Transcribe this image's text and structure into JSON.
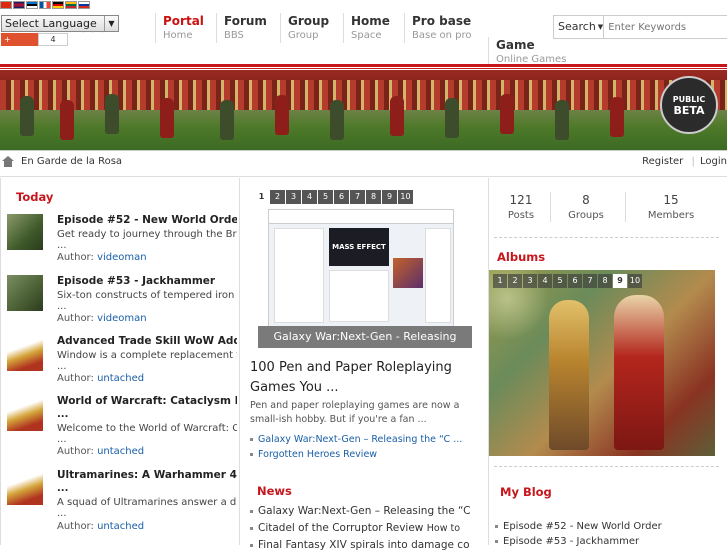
{
  "header": {
    "language_select": "Select Language",
    "share_label": "Share",
    "share_count": "4",
    "nav": [
      {
        "title": "Portal",
        "sub": "Home"
      },
      {
        "title": "Forum",
        "sub": "BBS"
      },
      {
        "title": "Group",
        "sub": "Group"
      },
      {
        "title": "Home",
        "sub": "Space"
      },
      {
        "title": "Pro base",
        "sub": "Base on pro"
      },
      {
        "title": "Game",
        "sub": "Online Games"
      }
    ],
    "search_button": "Search",
    "search_placeholder": "Enter Keywords"
  },
  "banner": {
    "badge_top": "PUBLIC",
    "badge_bottom": "BETA"
  },
  "breadcrumb": {
    "site": "En Garde de la Rosa"
  },
  "account": {
    "register": "Register",
    "login": "Login"
  },
  "today": {
    "title": "Today",
    "items": [
      {
        "title": "Episode #52 - New World Order",
        "desc": "Get ready to journey through the Br",
        "ellipsis": "...",
        "author_label": "Author:",
        "author": "videoman"
      },
      {
        "title": "Episode #53 - Jackhammer",
        "desc": "Six-ton constructs of tempered iron",
        "ellipsis": "...",
        "author_label": "Author:",
        "author": "videoman"
      },
      {
        "title": "Advanced Trade Skill WoW Addon",
        "desc": "Window is a complete replacement fo",
        "ellipsis": "...",
        "author_label": "Author:",
        "author": "untached"
      },
      {
        "title": "World of Warcraft: Cataclysm B",
        "title2": "...",
        "desc": "Welcome to the World of Warcraft: C",
        "ellipsis": "...",
        "author_label": "Author:",
        "author": "untached"
      },
      {
        "title": "Ultramarines: A Warhammer 40,0",
        "title2": "...",
        "desc": "A squad of Ultramarines answer a d",
        "ellipsis": "...",
        "author_label": "Author:",
        "author": "untached"
      }
    ]
  },
  "slider": {
    "pages": [
      "1",
      "2",
      "3",
      "4",
      "5",
      "6",
      "7",
      "8",
      "9",
      "10"
    ],
    "current_index": 0,
    "caption": "Galaxy War:Next-Gen - Releasing",
    "shot_badge": "MASS EFFECT"
  },
  "feature": {
    "title": "100 Pen and Paper Roleplaying Games You ...",
    "desc": "Pen and paper roleplaying games are now a small-ish hobby. But if you're a fan ...",
    "links": [
      "Galaxy War:Next-Gen – Releasing the “C ...",
      "Forgotten Heroes Review"
    ]
  },
  "news": {
    "title": "News",
    "items": [
      {
        "text": "Galaxy War:Next-Gen – Releasing the “C",
        "extra": ""
      },
      {
        "text": "Citadel of the Corruptor Review",
        "extra": "How to"
      },
      {
        "text": "Final Fantasy XIV spirals into damage co",
        "extra": ""
      }
    ]
  },
  "stats": [
    {
      "value": "121",
      "label": "Posts"
    },
    {
      "value": "8",
      "label": "Groups"
    },
    {
      "value": "15",
      "label": "Members"
    }
  ],
  "albums": {
    "title": "Albums",
    "pages": [
      "1",
      "2",
      "3",
      "4",
      "5",
      "6",
      "7",
      "8",
      "9",
      "10"
    ],
    "current_index": 8
  },
  "blog": {
    "title": "My Blog",
    "items": [
      "Episode #52 - New World Order",
      "Episode #53 - Jackhammer"
    ]
  },
  "colors": {
    "accent": "#c8161d",
    "link": "#1a5fa8"
  }
}
